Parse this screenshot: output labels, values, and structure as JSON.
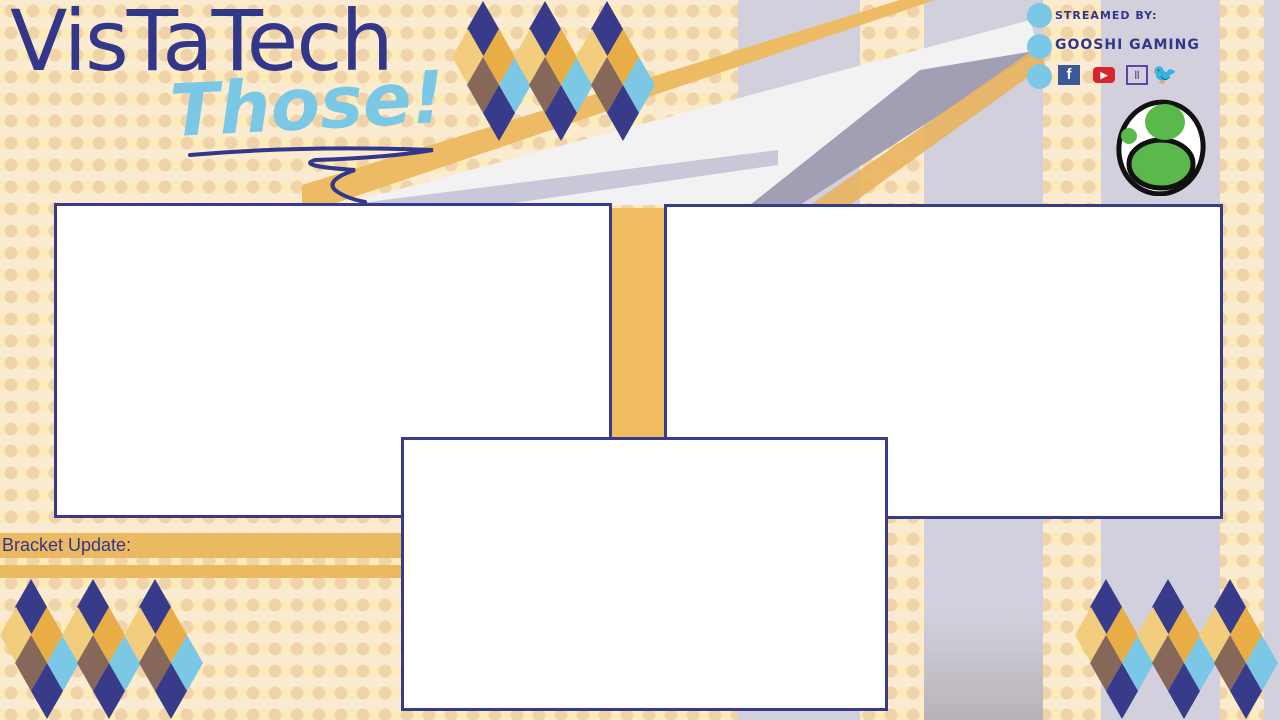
{
  "branding": {
    "title": "VisTaTech",
    "subtitle": "Those!"
  },
  "credits": {
    "streamed_by_label": "STREAMED BY:",
    "streamer_name": "GOOSHI GAMING",
    "social_icons": [
      "facebook-icon",
      "youtube-icon",
      "twitch-icon",
      "twitter-icon"
    ],
    "logo": "yoshi-egg-logo"
  },
  "bracket": {
    "label": "Bracket Update:"
  },
  "colors": {
    "navy": "#383a8a",
    "orange": "#e8ae45",
    "light_orange": "#f3cd7e",
    "brown": "#86685a",
    "light_blue": "#7ac8e6",
    "stripe_grey": "#d2d0dc"
  }
}
